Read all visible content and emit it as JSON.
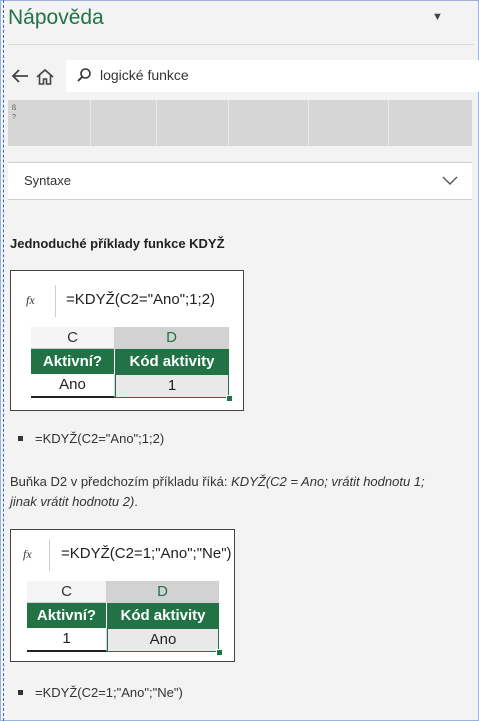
{
  "pane": {
    "title": "Nápověda"
  },
  "search": {
    "value": "logické funkce"
  },
  "strip": {
    "text": "ß ?"
  },
  "accordion": {
    "label": "Syntaxe"
  },
  "section": {
    "heading": "Jednoduché příklady funkce KDYŽ"
  },
  "example1": {
    "fx": "fx",
    "formula": "=KDYŽ(C2=\"Ano\";1;2)",
    "columns": [
      "C",
      "D"
    ],
    "headers": [
      "Aktivní?",
      "Kód aktivity"
    ],
    "values": [
      "Ano",
      "1"
    ]
  },
  "bullet1": {
    "text": "=KDYŽ(C2=\"Ano\";1;2)"
  },
  "description": {
    "plain": "Buňka D2 v předchozím příkladu říká: ",
    "italic": "KDYŽ(C2 = Ano; vrátit hodnotu 1; jinak vrátit hodnotu 2)",
    "end": "."
  },
  "example2": {
    "fx": "fx",
    "formula": "=KDYŽ(C2=1;\"Ano\";\"Ne\")",
    "columns": [
      "C",
      "D"
    ],
    "headers": [
      "Aktivní?",
      "Kód aktivity"
    ],
    "values": [
      "1",
      "Ano"
    ]
  },
  "bullet2": {
    "text": "=KDYŽ(C2=1;\"Ano\";\"Ne\")"
  },
  "colors": {
    "accent": "#217346",
    "pane_bg": "#f3f3f3"
  }
}
